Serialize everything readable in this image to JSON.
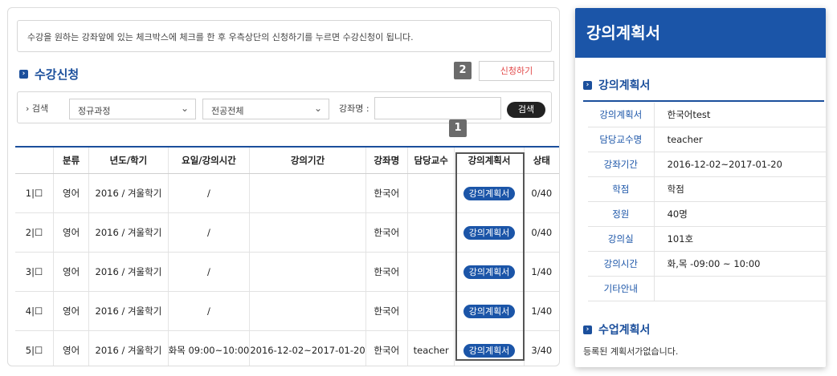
{
  "notice": "수강을 원하는 강좌앞에 있는 체크박스에 체크를 한 후 우측상단의 신청하기를 누르면 수강신청이 됩니다.",
  "section_title": "수강신청",
  "apply_button": "신청하기",
  "badges": {
    "apply": "2",
    "plan_column": "1"
  },
  "search": {
    "label": "검색",
    "course_type": "정규과정",
    "major": "전공전체",
    "course_name_label": "강좌명 :",
    "course_name_value": "",
    "search_button": "검색"
  },
  "table": {
    "headers": [
      "",
      "분류",
      "년도/학기",
      "요일/강의시간",
      "강의기간",
      "강좌명",
      "담당교수",
      "강의계획서",
      "상태"
    ],
    "rows": [
      {
        "no": "1|☐",
        "category": "영어",
        "term": "2016 / 겨울학기",
        "time": "/",
        "period": "",
        "course": "한국어",
        "professor": "",
        "plan": "강의계획서",
        "status": "0/40"
      },
      {
        "no": "2|☐",
        "category": "영어",
        "term": "2016 / 겨울학기",
        "time": "/",
        "period": "",
        "course": "한국어",
        "professor": "",
        "plan": "강의계획서",
        "status": "0/40"
      },
      {
        "no": "3|☐",
        "category": "영어",
        "term": "2016 / 겨울학기",
        "time": "/",
        "period": "",
        "course": "한국어",
        "professor": "",
        "plan": "강의계획서",
        "status": "1/40"
      },
      {
        "no": "4|☐",
        "category": "영어",
        "term": "2016 / 겨울학기",
        "time": "/",
        "period": "",
        "course": "한국어",
        "professor": "",
        "plan": "강의계획서",
        "status": "1/40"
      },
      {
        "no": "5|☐",
        "category": "영어",
        "term": "2016 / 겨울학기",
        "time": "화목 09:00~10:00",
        "period": "2016-12-02~2017-01-20",
        "course": "한국어",
        "professor": "teacher",
        "plan": "강의계획서",
        "status": "3/40"
      }
    ]
  },
  "panel": {
    "title": "강의계획서",
    "section1": "강의계획서",
    "info": [
      {
        "key": "강의계획서",
        "value": "한국어test"
      },
      {
        "key": "담당교수명",
        "value": "teacher"
      },
      {
        "key": "강좌기간",
        "value": "2016-12-02~2017-01-20"
      },
      {
        "key": "학점",
        "value": "학점"
      },
      {
        "key": "정원",
        "value": "40명"
      },
      {
        "key": "강의실",
        "value": "101호"
      },
      {
        "key": "강의시간",
        "value": "화,목 -09:00 ~ 10:00"
      },
      {
        "key": "기타안내",
        "value": ""
      }
    ],
    "section2": "수업계획서",
    "plan_text": "등록된 계획서가없습니다."
  },
  "colors": {
    "accent": "#1b55a8",
    "apply_text": "#e24a4a"
  }
}
